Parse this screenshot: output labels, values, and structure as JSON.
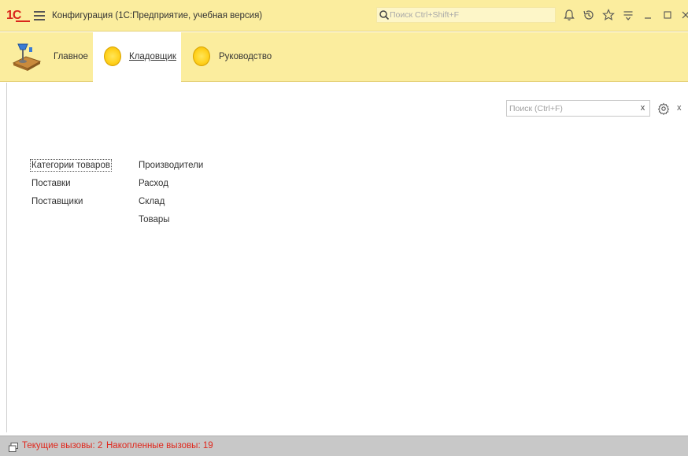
{
  "titlebar": {
    "logo": "1С",
    "title": "Конфигурация  (1С:Предприятие, учебная версия)",
    "search_placeholder": "Поиск Ctrl+Shift+F"
  },
  "sections": [
    {
      "label": "Главное"
    },
    {
      "label": "Кладовщик",
      "active": true
    },
    {
      "label": "Руководство"
    }
  ],
  "workspace": {
    "search_placeholder": "Поиск (Ctrl+F)",
    "clear_label": "x",
    "close_label": "x",
    "column1": [
      "Категории товаров",
      "Поставки",
      "Поставщики"
    ],
    "column2": [
      "Производители",
      "Расход",
      "Склад",
      "Товары"
    ]
  },
  "statusbar": {
    "current_calls": "Текущие вызовы: 2",
    "accumulated_calls": "Накопленные вызовы: 19"
  },
  "colors": {
    "panel": "#fbed9e",
    "brand_red": "#d9251c",
    "status_text": "#e0261b"
  }
}
